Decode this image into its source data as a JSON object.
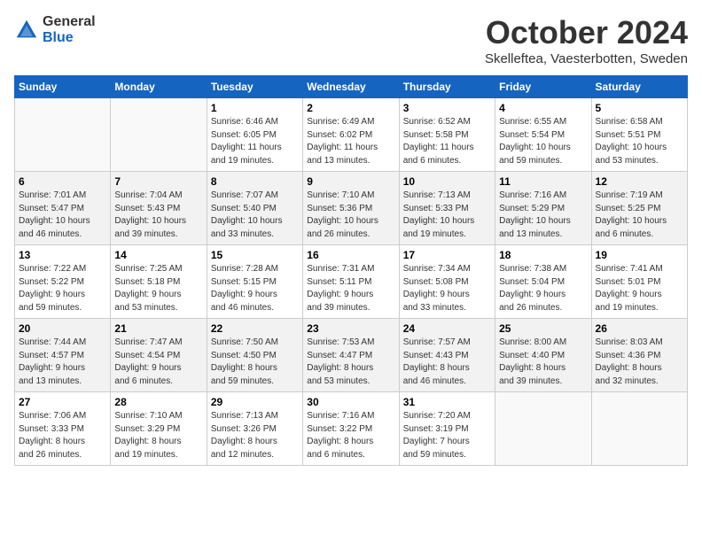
{
  "header": {
    "logo_general": "General",
    "logo_blue": "Blue",
    "month_title": "October 2024",
    "subtitle": "Skelleftea, Vaesterbotten, Sweden"
  },
  "weekdays": [
    "Sunday",
    "Monday",
    "Tuesday",
    "Wednesday",
    "Thursday",
    "Friday",
    "Saturday"
  ],
  "weeks": [
    [
      {
        "day": "",
        "info": ""
      },
      {
        "day": "",
        "info": ""
      },
      {
        "day": "1",
        "info": "Sunrise: 6:46 AM\nSunset: 6:05 PM\nDaylight: 11 hours\nand 19 minutes."
      },
      {
        "day": "2",
        "info": "Sunrise: 6:49 AM\nSunset: 6:02 PM\nDaylight: 11 hours\nand 13 minutes."
      },
      {
        "day": "3",
        "info": "Sunrise: 6:52 AM\nSunset: 5:58 PM\nDaylight: 11 hours\nand 6 minutes."
      },
      {
        "day": "4",
        "info": "Sunrise: 6:55 AM\nSunset: 5:54 PM\nDaylight: 10 hours\nand 59 minutes."
      },
      {
        "day": "5",
        "info": "Sunrise: 6:58 AM\nSunset: 5:51 PM\nDaylight: 10 hours\nand 53 minutes."
      }
    ],
    [
      {
        "day": "6",
        "info": "Sunrise: 7:01 AM\nSunset: 5:47 PM\nDaylight: 10 hours\nand 46 minutes."
      },
      {
        "day": "7",
        "info": "Sunrise: 7:04 AM\nSunset: 5:43 PM\nDaylight: 10 hours\nand 39 minutes."
      },
      {
        "day": "8",
        "info": "Sunrise: 7:07 AM\nSunset: 5:40 PM\nDaylight: 10 hours\nand 33 minutes."
      },
      {
        "day": "9",
        "info": "Sunrise: 7:10 AM\nSunset: 5:36 PM\nDaylight: 10 hours\nand 26 minutes."
      },
      {
        "day": "10",
        "info": "Sunrise: 7:13 AM\nSunset: 5:33 PM\nDaylight: 10 hours\nand 19 minutes."
      },
      {
        "day": "11",
        "info": "Sunrise: 7:16 AM\nSunset: 5:29 PM\nDaylight: 10 hours\nand 13 minutes."
      },
      {
        "day": "12",
        "info": "Sunrise: 7:19 AM\nSunset: 5:25 PM\nDaylight: 10 hours\nand 6 minutes."
      }
    ],
    [
      {
        "day": "13",
        "info": "Sunrise: 7:22 AM\nSunset: 5:22 PM\nDaylight: 9 hours\nand 59 minutes."
      },
      {
        "day": "14",
        "info": "Sunrise: 7:25 AM\nSunset: 5:18 PM\nDaylight: 9 hours\nand 53 minutes."
      },
      {
        "day": "15",
        "info": "Sunrise: 7:28 AM\nSunset: 5:15 PM\nDaylight: 9 hours\nand 46 minutes."
      },
      {
        "day": "16",
        "info": "Sunrise: 7:31 AM\nSunset: 5:11 PM\nDaylight: 9 hours\nand 39 minutes."
      },
      {
        "day": "17",
        "info": "Sunrise: 7:34 AM\nSunset: 5:08 PM\nDaylight: 9 hours\nand 33 minutes."
      },
      {
        "day": "18",
        "info": "Sunrise: 7:38 AM\nSunset: 5:04 PM\nDaylight: 9 hours\nand 26 minutes."
      },
      {
        "day": "19",
        "info": "Sunrise: 7:41 AM\nSunset: 5:01 PM\nDaylight: 9 hours\nand 19 minutes."
      }
    ],
    [
      {
        "day": "20",
        "info": "Sunrise: 7:44 AM\nSunset: 4:57 PM\nDaylight: 9 hours\nand 13 minutes."
      },
      {
        "day": "21",
        "info": "Sunrise: 7:47 AM\nSunset: 4:54 PM\nDaylight: 9 hours\nand 6 minutes."
      },
      {
        "day": "22",
        "info": "Sunrise: 7:50 AM\nSunset: 4:50 PM\nDaylight: 8 hours\nand 59 minutes."
      },
      {
        "day": "23",
        "info": "Sunrise: 7:53 AM\nSunset: 4:47 PM\nDaylight: 8 hours\nand 53 minutes."
      },
      {
        "day": "24",
        "info": "Sunrise: 7:57 AM\nSunset: 4:43 PM\nDaylight: 8 hours\nand 46 minutes."
      },
      {
        "day": "25",
        "info": "Sunrise: 8:00 AM\nSunset: 4:40 PM\nDaylight: 8 hours\nand 39 minutes."
      },
      {
        "day": "26",
        "info": "Sunrise: 8:03 AM\nSunset: 4:36 PM\nDaylight: 8 hours\nand 32 minutes."
      }
    ],
    [
      {
        "day": "27",
        "info": "Sunrise: 7:06 AM\nSunset: 3:33 PM\nDaylight: 8 hours\nand 26 minutes."
      },
      {
        "day": "28",
        "info": "Sunrise: 7:10 AM\nSunset: 3:29 PM\nDaylight: 8 hours\nand 19 minutes."
      },
      {
        "day": "29",
        "info": "Sunrise: 7:13 AM\nSunset: 3:26 PM\nDaylight: 8 hours\nand 12 minutes."
      },
      {
        "day": "30",
        "info": "Sunrise: 7:16 AM\nSunset: 3:22 PM\nDaylight: 8 hours\nand 6 minutes."
      },
      {
        "day": "31",
        "info": "Sunrise: 7:20 AM\nSunset: 3:19 PM\nDaylight: 7 hours\nand 59 minutes."
      },
      {
        "day": "",
        "info": ""
      },
      {
        "day": "",
        "info": ""
      }
    ]
  ]
}
